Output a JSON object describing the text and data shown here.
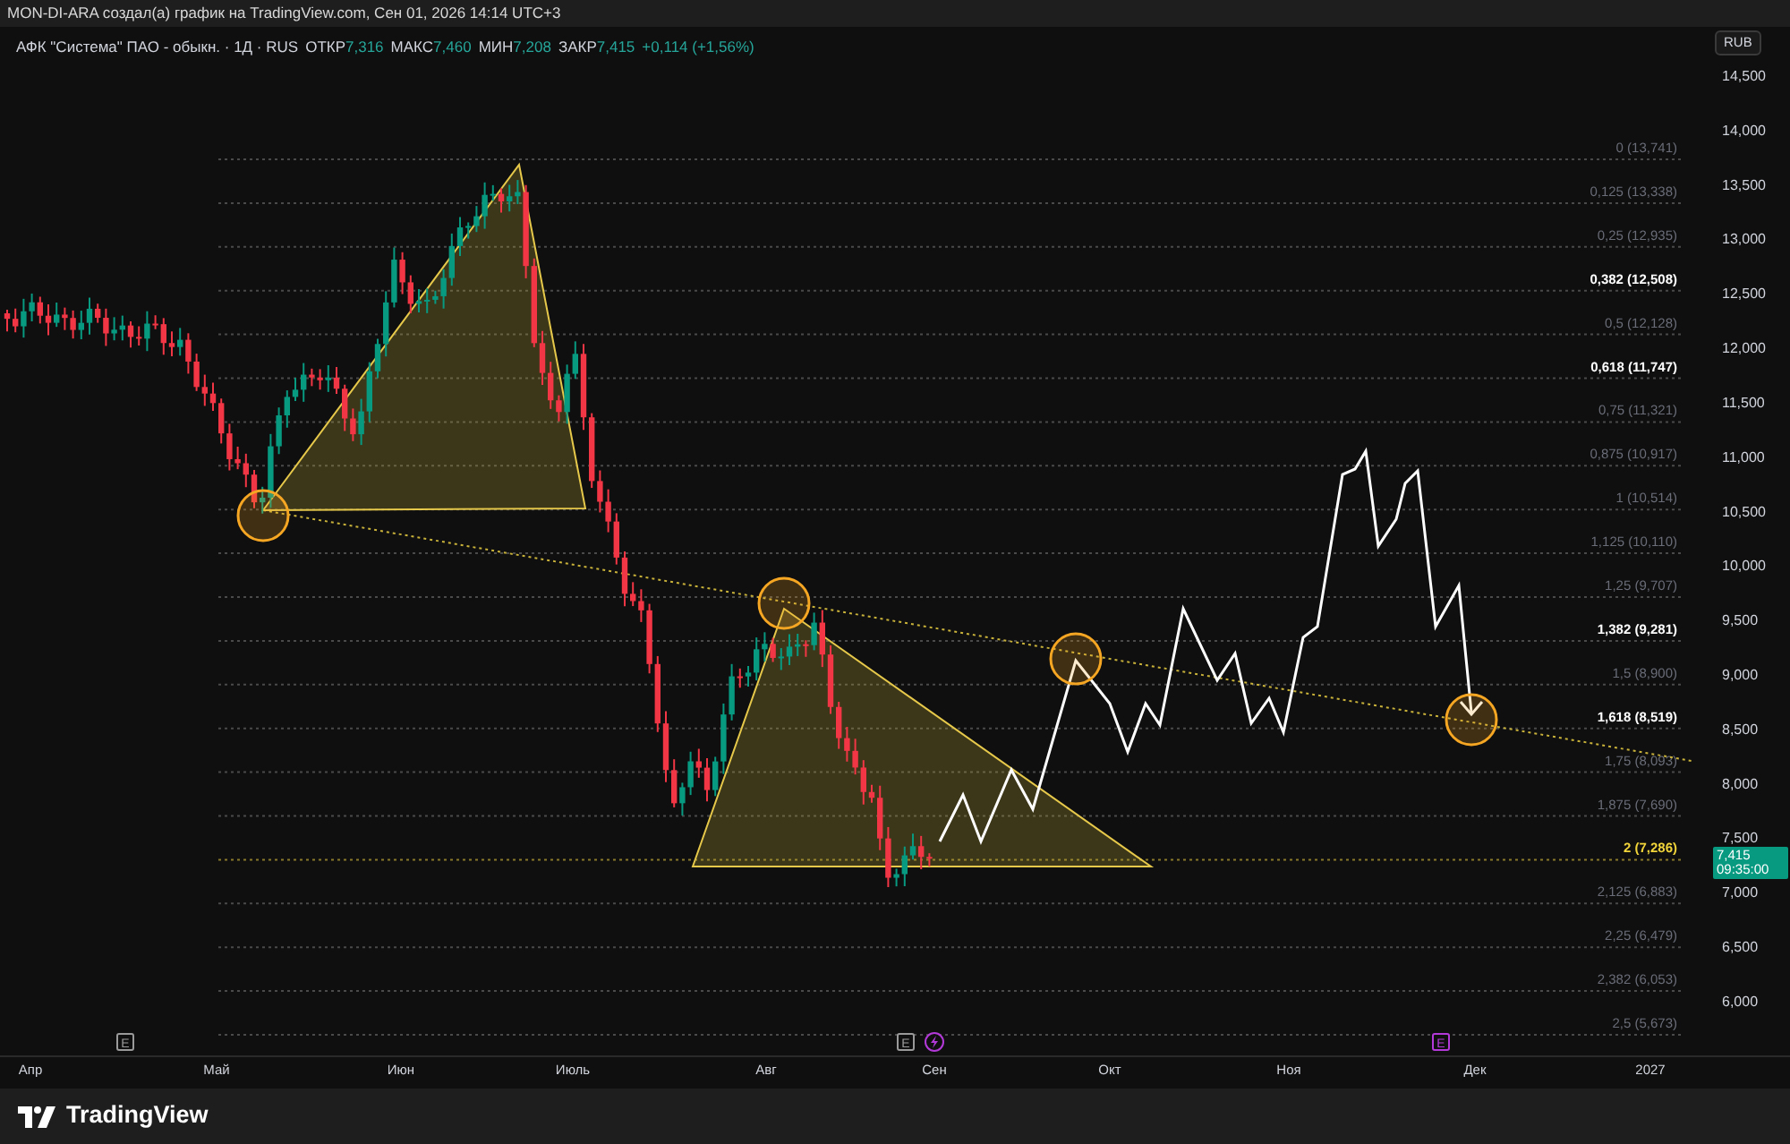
{
  "header": {
    "title": "MON-DI-ARA создал(а) график на TradingView.com, Сен 01, 2026 14:14 UTC+3"
  },
  "legend": {
    "symbol": "АФК \"Система\" ПАО - обыкн. · 1Д · RUS",
    "fields": [
      {
        "label": "ОТКР",
        "value": "7,316"
      },
      {
        "label": "МАКС",
        "value": "7,460"
      },
      {
        "label": "МИН",
        "value": "7,208"
      },
      {
        "label": "ЗАКР",
        "value": "7,415"
      }
    ],
    "change": "+0,114 (+1,56%)"
  },
  "currency_button": "RUB",
  "price_axis": {
    "labels": [
      "14,500",
      "14,000",
      "13,500",
      "13,000",
      "12,500",
      "12,000",
      "11,500",
      "11,000",
      "10,500",
      "10,000",
      "9,500",
      "9,000",
      "8,500",
      "8,000",
      "7,500",
      "7,000",
      "6,500",
      "6,000"
    ]
  },
  "price_tag": {
    "price": "7,415",
    "countdown": "09:35:00"
  },
  "fib_levels": [
    {
      "label": "0 (13,741)",
      "kind": "minor"
    },
    {
      "label": "0,125 (13,338)",
      "kind": "minor"
    },
    {
      "label": "0,25 (12,935)",
      "kind": "minor"
    },
    {
      "label": "0,382 (12,508)",
      "kind": "key"
    },
    {
      "label": "0,5 (12,128)",
      "kind": "minor"
    },
    {
      "label": "0,618 (11,747)",
      "kind": "key"
    },
    {
      "label": "0,75 (11,321)",
      "kind": "minor"
    },
    {
      "label": "0,875 (10,917)",
      "kind": "minor"
    },
    {
      "label": "1 (10,514)",
      "kind": "minor"
    },
    {
      "label": "1,125 (10,110)",
      "kind": "minor"
    },
    {
      "label": "1,25 (9,707)",
      "kind": "minor"
    },
    {
      "label": "1,382 (9,281)",
      "kind": "key"
    },
    {
      "label": "1,5 (8,900)",
      "kind": "minor"
    },
    {
      "label": "1,618 (8,519)",
      "kind": "key"
    },
    {
      "label": "1,75 (8,093)",
      "kind": "minor"
    },
    {
      "label": "1,875 (7,690)",
      "kind": "minor"
    },
    {
      "label": "2 (7,286)",
      "kind": "current"
    },
    {
      "label": "2,125 (6,883)",
      "kind": "minor"
    },
    {
      "label": "2,25 (6,479)",
      "kind": "minor"
    },
    {
      "label": "2,382 (6,053)",
      "kind": "minor"
    },
    {
      "label": "2,5 (5,673)",
      "kind": "minor"
    }
  ],
  "event_markers": [
    {
      "kind": "earnings",
      "label": "E",
      "upcoming": false
    },
    {
      "kind": "earnings",
      "label": "E",
      "upcoming": false
    },
    {
      "kind": "split"
    },
    {
      "kind": "earnings",
      "label": "E",
      "upcoming": true
    }
  ],
  "time_axis": {
    "labels": [
      "Апр",
      "Май",
      "Июн",
      "Июль",
      "Авг",
      "Сен",
      "Окт",
      "Ноя",
      "Дек",
      "2027"
    ]
  },
  "footer": {
    "brand": "TradingView"
  }
}
